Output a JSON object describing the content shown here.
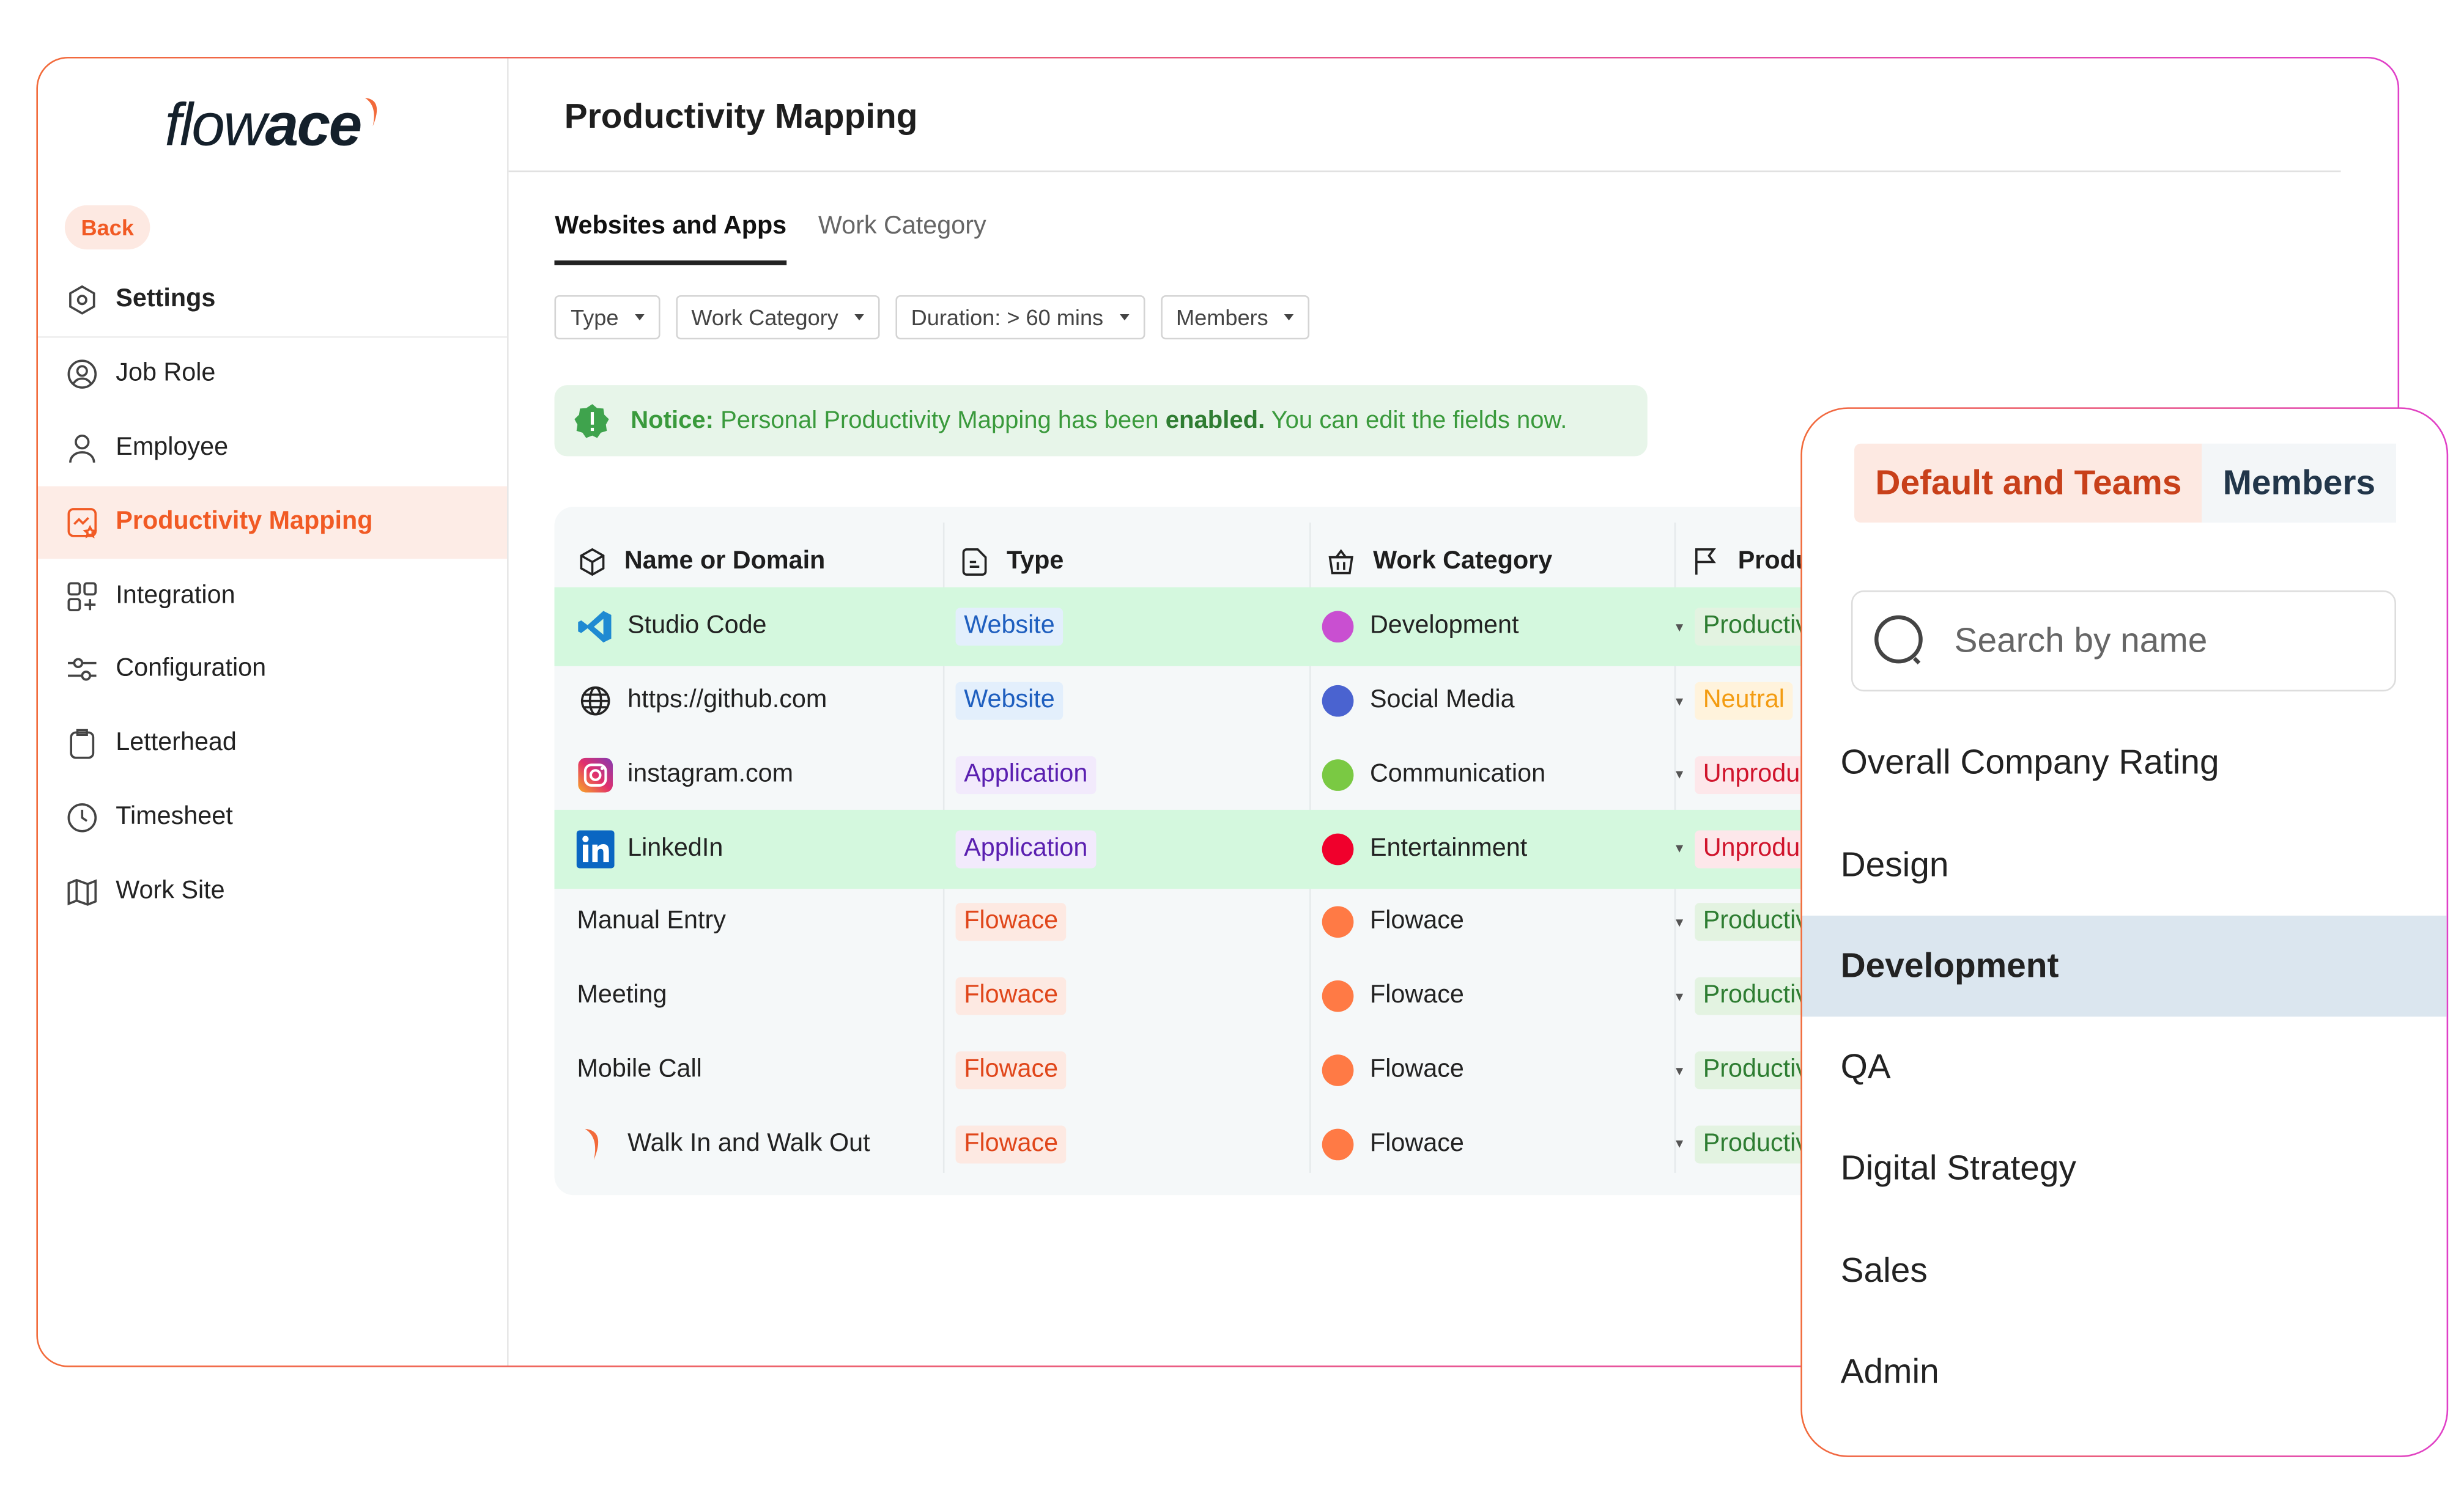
{
  "brand": {
    "logo_text_light": "flow",
    "logo_text_bold": "ace",
    "accent": "#f15a24"
  },
  "sidebar": {
    "back_label": "Back",
    "items": [
      {
        "label": "Settings",
        "icon": "settings-hexagon-icon"
      },
      {
        "label": "Job Role",
        "icon": "user-circle-icon"
      },
      {
        "label": "Employee",
        "icon": "user-icon"
      },
      {
        "label": "Productivity Mapping",
        "icon": "chart-star-icon",
        "active": true
      },
      {
        "label": "Integration",
        "icon": "grid-plus-icon"
      },
      {
        "label": "Configuration",
        "icon": "sliders-icon"
      },
      {
        "label": "Letterhead",
        "icon": "clipboard-icon"
      },
      {
        "label": "Timesheet",
        "icon": "clock-icon"
      },
      {
        "label": "Work Site",
        "icon": "map-icon"
      }
    ]
  },
  "main": {
    "title": "Productivity Mapping",
    "tabs": [
      {
        "label": "Websites and Apps",
        "active": true
      },
      {
        "label": "Work Category"
      }
    ],
    "filters": [
      "Type",
      "Work Category",
      "Duration: > 60 mins",
      "Members"
    ],
    "notice": {
      "prefix": "Notice:",
      "text1": " Personal Productivity Mapping has been ",
      "bold": "enabled.",
      "text2": " You can edit the fields now."
    },
    "table": {
      "headers": [
        "Name or Domain",
        "Type",
        "Work Category",
        "Produ"
      ],
      "rows": [
        {
          "name": "Studio Code",
          "icon": "vscode-icon",
          "type": "Website",
          "category": "Development",
          "cat_color": "#c94fd1",
          "productivity": "Productiv",
          "highlight": true
        },
        {
          "name": "https://github.com",
          "icon": "globe-icon",
          "type": "Website",
          "category": "Social Media",
          "cat_color": "#4a63d0",
          "productivity": "Neutral"
        },
        {
          "name": "instagram.com",
          "icon": "instagram-icon",
          "type": "Application",
          "category": "Communication",
          "cat_color": "#7ac943",
          "productivity": "Unproduc"
        },
        {
          "name": "LinkedIn",
          "icon": "linkedin-icon",
          "type": "Application",
          "category": "Entertainment",
          "cat_color": "#f0002c",
          "productivity": "Unproduc",
          "highlight": true
        },
        {
          "name": "Manual Entry",
          "icon": "",
          "type": "Flowace",
          "category": "Flowace",
          "cat_color": "#ff7a45",
          "productivity": "Productiv"
        },
        {
          "name": "Meeting",
          "icon": "",
          "type": "Flowace",
          "category": "Flowace",
          "cat_color": "#ff7a45",
          "productivity": "Productiv"
        },
        {
          "name": "Mobile Call",
          "icon": "",
          "type": "Flowace",
          "category": "Flowace",
          "cat_color": "#ff7a45",
          "productivity": "Productiv"
        },
        {
          "name": "Walk In and Walk Out",
          "icon": "flowace-swoosh-icon",
          "type": "Flowace",
          "category": "Flowace",
          "cat_color": "#ff7a45",
          "productivity": "Productiv"
        }
      ]
    }
  },
  "popup": {
    "tabs": [
      {
        "label": "Default and Teams",
        "active": true
      },
      {
        "label": "Members"
      }
    ],
    "search_placeholder": "Search by name",
    "options": [
      "Overall Company Rating",
      "Design",
      "Development",
      "QA",
      "Digital Strategy",
      "Sales",
      "Admin"
    ],
    "selected": "Development"
  }
}
